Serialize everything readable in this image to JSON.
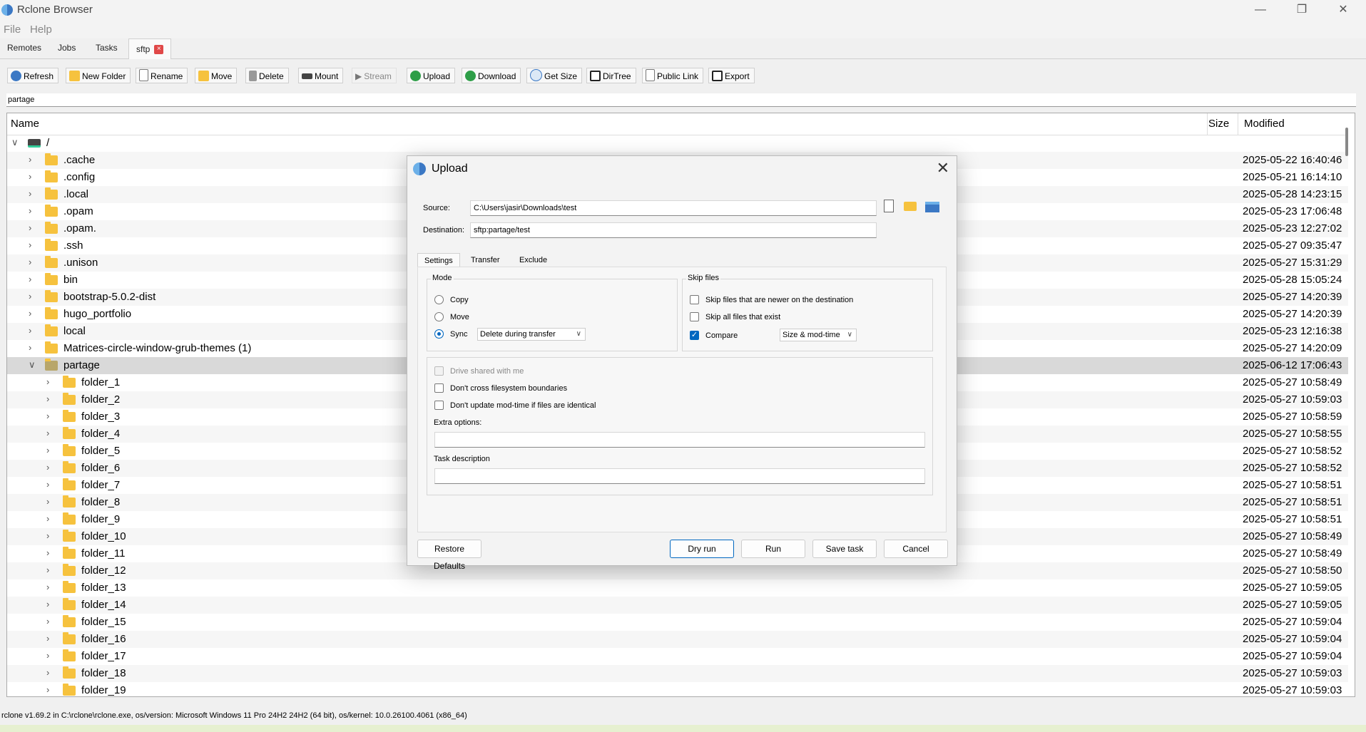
{
  "window": {
    "title": "Rclone Browser"
  },
  "menu": [
    "File",
    "Help"
  ],
  "tabs": [
    "Remotes",
    "Jobs",
    "Tasks"
  ],
  "active_tab": {
    "label": "sftp",
    "close": "×"
  },
  "toolbar": {
    "refresh": "Refresh",
    "new_folder": "New Folder",
    "rename": "Rename",
    "move": "Move",
    "delete": "Delete",
    "mount": "Mount",
    "stream": "Stream",
    "upload": "Upload",
    "download": "Download",
    "get_size": "Get Size",
    "dirtree": "DirTree",
    "public_link": "Public Link",
    "export": "Export"
  },
  "path": "partage",
  "columns": {
    "name": "Name",
    "size": "Size",
    "modified": "Modified"
  },
  "root": {
    "name": "/"
  },
  "rows": [
    {
      "name": ".cache",
      "mod": "2025-05-22 16:40:46"
    },
    {
      "name": ".config",
      "mod": "2025-05-21 16:14:10"
    },
    {
      "name": ".local",
      "mod": "2025-05-28 14:23:15"
    },
    {
      "name": ".opam",
      "mod": "2025-05-23 17:06:48"
    },
    {
      "name": ".opam.",
      "mod": "2025-05-23 12:27:02"
    },
    {
      "name": ".ssh",
      "mod": "2025-05-27 09:35:47"
    },
    {
      "name": ".unison",
      "mod": "2025-05-27 15:31:29"
    },
    {
      "name": "bin",
      "mod": "2025-05-28 15:05:24"
    },
    {
      "name": "bootstrap-5.0.2-dist",
      "mod": "2025-05-27 14:20:39"
    },
    {
      "name": "hugo_portfolio",
      "mod": "2025-05-27 14:20:39"
    },
    {
      "name": "local",
      "mod": "2025-05-23 12:16:38"
    },
    {
      "name": "Matrices-circle-window-grub-themes (1)",
      "mod": "2025-05-27 14:20:09"
    },
    {
      "name": "partage",
      "mod": "2025-06-12 17:06:43"
    },
    {
      "name": "folder_1",
      "mod": "2025-05-27 10:58:49"
    },
    {
      "name": "folder_2",
      "mod": "2025-05-27 10:59:03"
    },
    {
      "name": "folder_3",
      "mod": "2025-05-27 10:58:59"
    },
    {
      "name": "folder_4",
      "mod": "2025-05-27 10:58:55"
    },
    {
      "name": "folder_5",
      "mod": "2025-05-27 10:58:52"
    },
    {
      "name": "folder_6",
      "mod": "2025-05-27 10:58:52"
    },
    {
      "name": "folder_7",
      "mod": "2025-05-27 10:58:51"
    },
    {
      "name": "folder_8",
      "mod": "2025-05-27 10:58:51"
    },
    {
      "name": "folder_9",
      "mod": "2025-05-27 10:58:51"
    },
    {
      "name": "folder_10",
      "mod": "2025-05-27 10:58:49"
    },
    {
      "name": "folder_11",
      "mod": "2025-05-27 10:58:49"
    },
    {
      "name": "folder_12",
      "mod": "2025-05-27 10:58:50"
    },
    {
      "name": "folder_13",
      "mod": "2025-05-27 10:59:05"
    },
    {
      "name": "folder_14",
      "mod": "2025-05-27 10:59:05"
    },
    {
      "name": "folder_15",
      "mod": "2025-05-27 10:59:04"
    },
    {
      "name": "folder_16",
      "mod": "2025-05-27 10:59:04"
    },
    {
      "name": "folder_17",
      "mod": "2025-05-27 10:59:04"
    },
    {
      "name": "folder_18",
      "mod": "2025-05-27 10:59:03"
    },
    {
      "name": "folder_19",
      "mod": "2025-05-27 10:59:03"
    }
  ],
  "status": "rclone v1.69.2 in C:\\rclone\\rclone.exe, os/version: Microsoft Windows 11 Pro 24H2 24H2 (64 bit), os/kernel: 10.0.26100.4061 (x86_64)",
  "dialog": {
    "title": "Upload",
    "source_label": "Source:",
    "source_value": "C:\\Users\\jasir\\Downloads\\test",
    "destination_label": "Destination:",
    "destination_value": "sftp:partage/test",
    "tabs": [
      "Settings",
      "Transfer",
      "Exclude"
    ],
    "mode_title": "Mode",
    "mode_copy": "Copy",
    "mode_move": "Move",
    "mode_sync": "Sync",
    "mode_selected": "Sync",
    "sync_option": "Delete during transfer",
    "skip_title": "Skip files",
    "skip_newer": "Skip files that are newer on the destination",
    "skip_existing": "Skip all files that exist",
    "compare": "Compare",
    "compare_checked": true,
    "compare_option": "Size & mod-time",
    "drive_shared": "Drive shared with me",
    "dont_cross": "Don't cross filesystem boundaries",
    "dont_update": "Don't update mod-time if files are identical",
    "extra_label": "Extra options:",
    "extra_value": "",
    "task_label": "Task description",
    "task_value": "",
    "restore": "Restore Defaults",
    "dry_run": "Dry run",
    "run": "Run",
    "save_task": "Save task",
    "cancel": "Cancel"
  }
}
